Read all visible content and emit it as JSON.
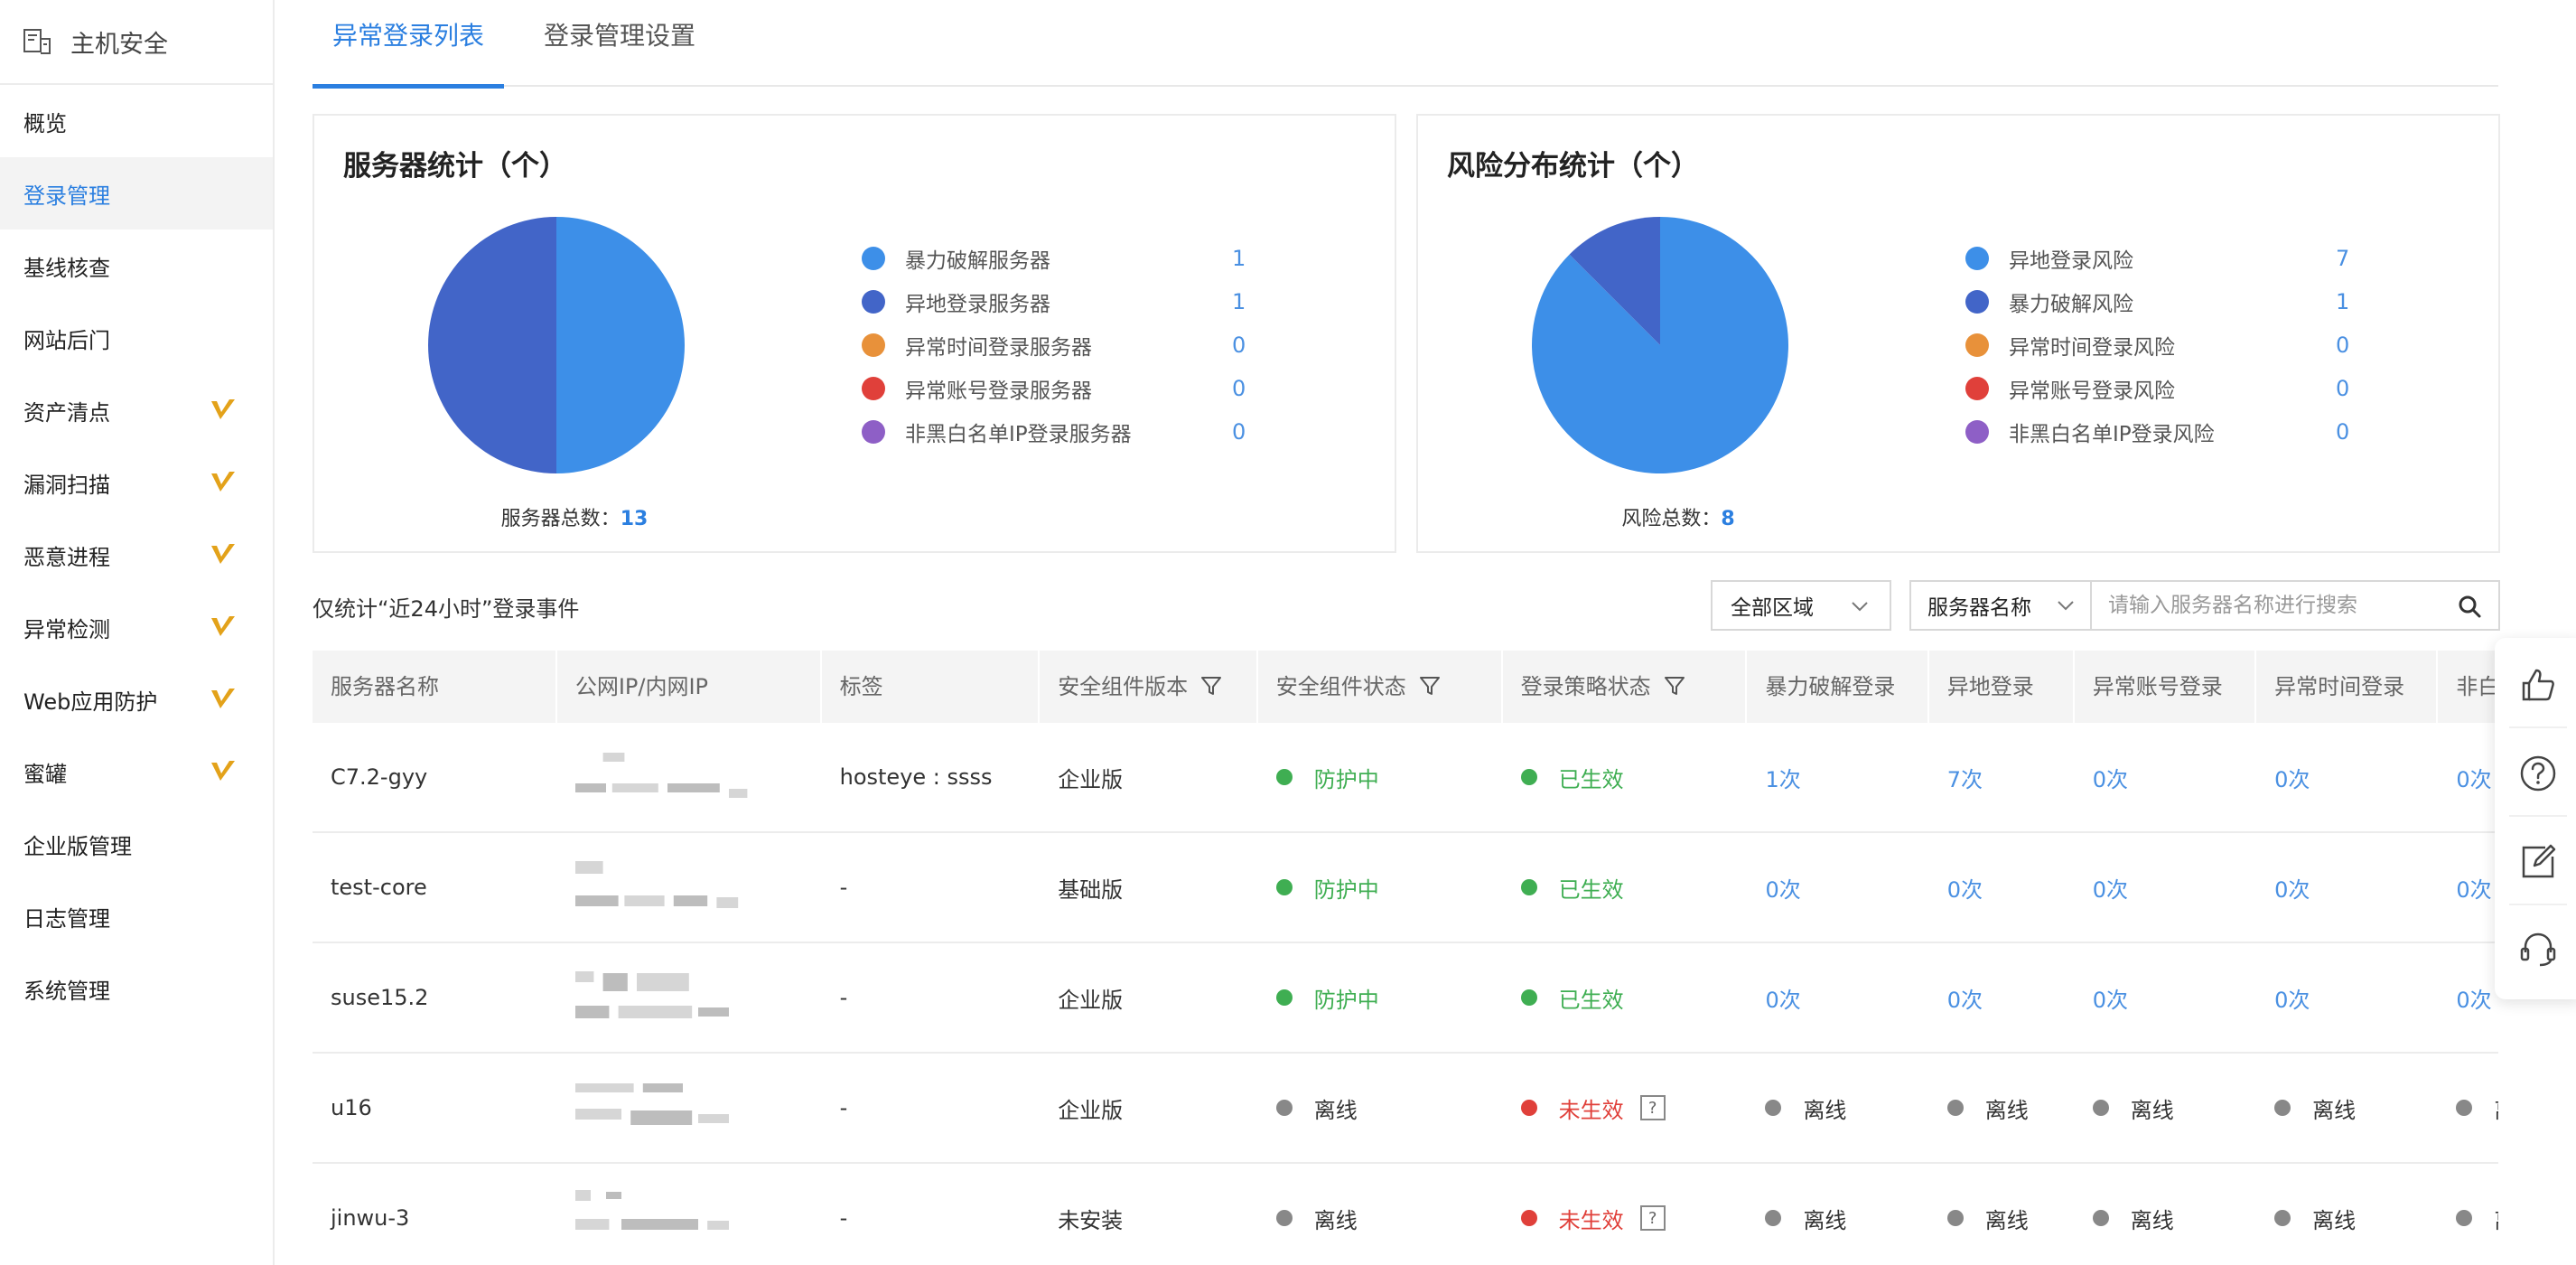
{
  "sidebar": {
    "title": "主机安全",
    "items": [
      {
        "label": "概览",
        "badge": false
      },
      {
        "label": "登录管理",
        "badge": false,
        "active": true
      },
      {
        "label": "基线核查",
        "badge": false
      },
      {
        "label": "网站后门",
        "badge": false
      },
      {
        "label": "资产清点",
        "badge": true
      },
      {
        "label": "漏洞扫描",
        "badge": true
      },
      {
        "label": "恶意进程",
        "badge": true
      },
      {
        "label": "异常检测",
        "badge": true
      },
      {
        "label": "Web应用防护",
        "badge": true
      },
      {
        "label": "蜜罐",
        "badge": true
      },
      {
        "label": "企业版管理",
        "badge": false
      },
      {
        "label": "日志管理",
        "badge": false
      },
      {
        "label": "系统管理",
        "badge": false
      }
    ]
  },
  "tabs": [
    {
      "label": "异常登录列表",
      "active": true
    },
    {
      "label": "登录管理设置",
      "active": false
    }
  ],
  "colors": {
    "accent": "#2b7fe0",
    "pie_blue": "#3d8fe8",
    "pie_indigo": "#4265c8",
    "orange": "#e8913a",
    "red": "#e0403a",
    "purple": "#8e5fc6",
    "green": "#3fae52",
    "gray": "#999999"
  },
  "server_stats": {
    "title": "服务器统计（个）",
    "total_label": "服务器总数：",
    "total": "13",
    "legend": [
      {
        "label": "暴力破解服务器",
        "value": "1",
        "color": "#3d8fe8"
      },
      {
        "label": "异地登录服务器",
        "value": "1",
        "color": "#4265c8"
      },
      {
        "label": "异常时间登录服务器",
        "value": "0",
        "color": "#e8913a"
      },
      {
        "label": "异常账号登录服务器",
        "value": "0",
        "color": "#e0403a"
      },
      {
        "label": "非黑白名单IP登录服务器",
        "value": "0",
        "color": "#8e5fc6"
      }
    ]
  },
  "risk_stats": {
    "title": "风险分布统计（个）",
    "total_label": "风险总数：",
    "total": "8",
    "legend": [
      {
        "label": "异地登录风险",
        "value": "7",
        "color": "#3d8fe8"
      },
      {
        "label": "暴力破解风险",
        "value": "1",
        "color": "#4265c8"
      },
      {
        "label": "异常时间登录风险",
        "value": "0",
        "color": "#e8913a"
      },
      {
        "label": "异常账号登录风险",
        "value": "0",
        "color": "#e0403a"
      },
      {
        "label": "非黑白名单IP登录风险",
        "value": "0",
        "color": "#8e5fc6"
      }
    ]
  },
  "chart_data": [
    {
      "type": "pie",
      "title": "服务器统计（个）",
      "categories": [
        "暴力破解服务器",
        "异地登录服务器",
        "异常时间登录服务器",
        "异常账号登录服务器",
        "非黑白名单IP登录服务器"
      ],
      "values": [
        1,
        1,
        0,
        0,
        0
      ],
      "colors": [
        "#3d8fe8",
        "#4265c8",
        "#e8913a",
        "#e0403a",
        "#8e5fc6"
      ]
    },
    {
      "type": "pie",
      "title": "风险分布统计（个）",
      "categories": [
        "异地登录风险",
        "暴力破解风险",
        "异常时间登录风险",
        "异常账号登录风险",
        "非黑白名单IP登录风险"
      ],
      "values": [
        7,
        1,
        0,
        0,
        0
      ],
      "colors": [
        "#3d8fe8",
        "#4265c8",
        "#e8913a",
        "#e0403a",
        "#8e5fc6"
      ]
    }
  ],
  "filters": {
    "note": "仅统计“近24小时”登录事件",
    "region": "全部区域",
    "search_type": "服务器名称",
    "search_placeholder": "请输入服务器名称进行搜索"
  },
  "table": {
    "columns": [
      "服务器名称",
      "公网IP/内网IP",
      "标签",
      "安全组件版本",
      "安全组件状态",
      "登录策略状态",
      "暴力破解登录",
      "异地登录",
      "异常账号登录",
      "异常时间登录",
      "非白名"
    ],
    "rows": [
      {
        "name": "C7.2-gyy",
        "tag": "hosteye : ssss",
        "version": "企业版",
        "status": "防护中",
        "status_color": "green",
        "policy": "已生效",
        "policy_color": "green",
        "policy_help": false,
        "brute": "1次",
        "remote": "7次",
        "account": "0次",
        "time": "0次",
        "nonwhite": "0次",
        "offline": false
      },
      {
        "name": "test-core",
        "tag": "-",
        "version": "基础版",
        "status": "防护中",
        "status_color": "green",
        "policy": "已生效",
        "policy_color": "green",
        "policy_help": false,
        "brute": "0次",
        "remote": "0次",
        "account": "0次",
        "time": "0次",
        "nonwhite": "0次",
        "offline": false
      },
      {
        "name": "suse15.2",
        "tag": "-",
        "version": "企业版",
        "status": "防护中",
        "status_color": "green",
        "policy": "已生效",
        "policy_color": "green",
        "policy_help": false,
        "brute": "0次",
        "remote": "0次",
        "account": "0次",
        "time": "0次",
        "nonwhite": "0次",
        "offline": false
      },
      {
        "name": "u16",
        "tag": "-",
        "version": "企业版",
        "status": "离线",
        "status_color": "gray",
        "policy": "未生效",
        "policy_color": "red",
        "policy_help": true,
        "brute": "离线",
        "remote": "离线",
        "account": "离线",
        "time": "离线",
        "nonwhite": "离",
        "offline": true
      },
      {
        "name": "jinwu-3",
        "tag": "-",
        "version": "未安装",
        "status": "离线",
        "status_color": "gray",
        "policy": "未生效",
        "policy_color": "red",
        "policy_help": true,
        "brute": "离线",
        "remote": "离线",
        "account": "离线",
        "time": "离线",
        "nonwhite": "离",
        "offline": true
      }
    ],
    "help_mark": "?"
  }
}
